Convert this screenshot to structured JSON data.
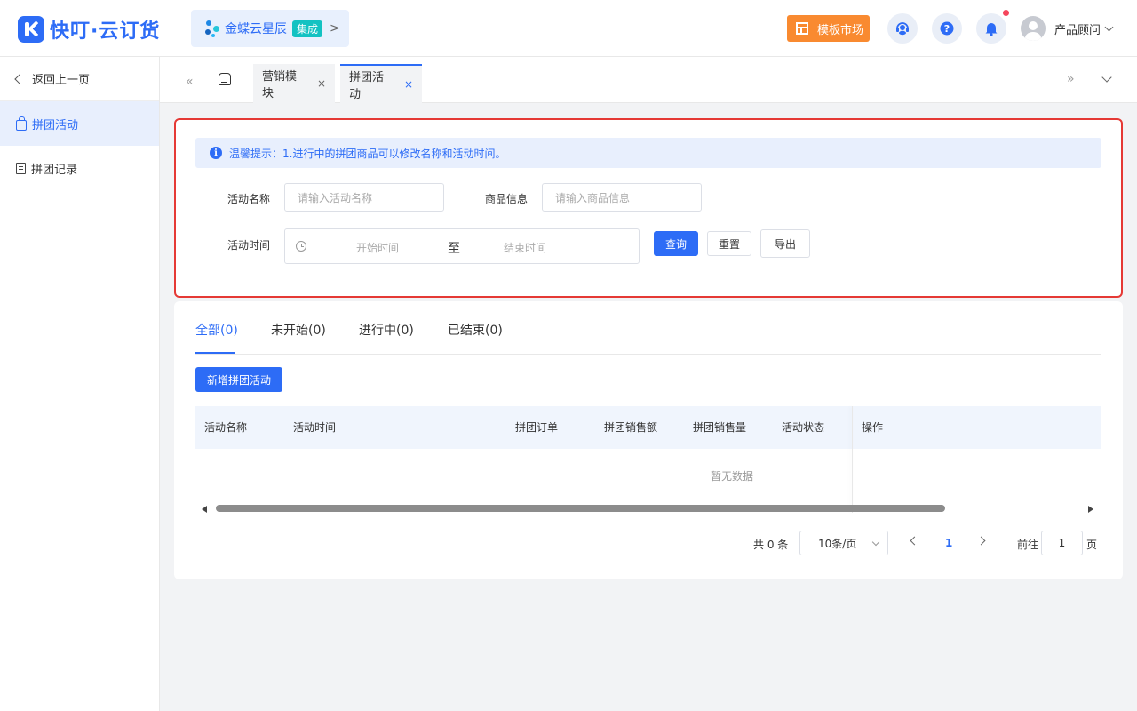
{
  "header": {
    "brand": "快叮·云订货",
    "kingdee_name": "金蝶云星辰",
    "kingdee_badge": "集成",
    "kingdee_arrow": ">",
    "market_label": "模板市场",
    "user_name": "产品顾问",
    "accent_color": "#2d6cf6",
    "market_color": "#f98a30",
    "icons": [
      "customer-service-icon",
      "help-icon",
      "bell-icon"
    ]
  },
  "sidebar": {
    "back_label": "返回上一页",
    "items": [
      {
        "label": "拼团活动",
        "icon": "shopping-bag-icon",
        "active": true
      },
      {
        "label": "拼团记录",
        "icon": "document-icon",
        "active": false
      }
    ]
  },
  "tabbar": {
    "tabs": [
      {
        "label": "营销模块",
        "close": "×"
      },
      {
        "label": "拼团活动",
        "close": "×",
        "active": true
      }
    ],
    "left_arrows": "«",
    "right_arrows": "»"
  },
  "filter": {
    "notice": "温馨提示：1.进行中的拼团商品可以修改名称和活动时间。",
    "activity_name_label": "活动名称",
    "activity_name_placeholder": "请输入活动名称",
    "goods_info_label": "商品信息",
    "goods_info_placeholder": "请输入商品信息",
    "activity_time_label": "活动时间",
    "start_placeholder": "开始时间",
    "range_separator": "至",
    "end_placeholder": "结束时间",
    "query_label": "查询",
    "reset_label": "重置",
    "export_label": "导出"
  },
  "list": {
    "status_tabs": [
      "全部(0)",
      "未开始(0)",
      "进行中(0)",
      "已结束(0)"
    ],
    "add_label": "新增拼团活动",
    "columns": [
      "活动名称",
      "活动时间",
      "拼团订单",
      "拼团销售额",
      "拼团销售量",
      "活动状态",
      "操作"
    ],
    "rows": [],
    "empty_text": "暂无数据"
  },
  "pagination": {
    "total": "共 0 条",
    "page_size": "10条/页",
    "current_page": "1",
    "goto_label": "前往",
    "goto_value": "1",
    "page_unit": "页"
  }
}
